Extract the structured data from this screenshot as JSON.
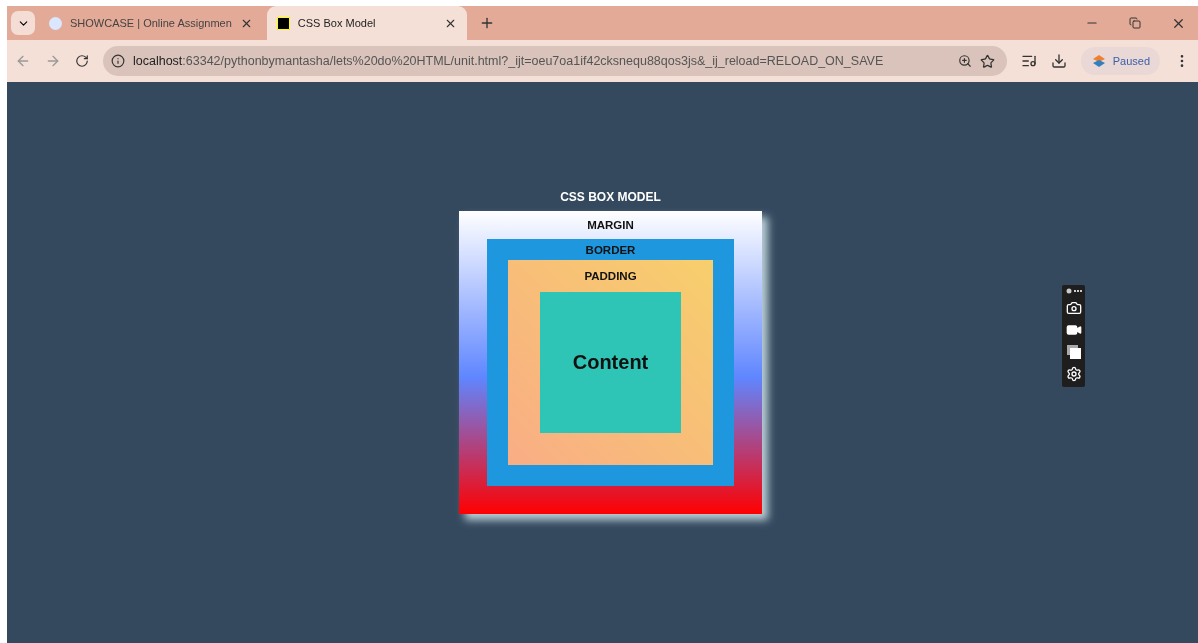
{
  "tabs": [
    {
      "title": "SHOWCASE | Online Assignmen",
      "selected": false
    },
    {
      "title": "CSS Box Model",
      "selected": true
    }
  ],
  "address_bar": {
    "url_host": "localhost",
    "url_rest": ":63342/pythonbymantasha/lets%20do%20HTML/unit.html?_ijt=oeu7oa1if42cksnequ88qos3js&_ij_reload=RELOAD_ON_SAVE"
  },
  "profile": {
    "label": "Paused"
  },
  "box_model": {
    "title": "CSS BOX MODEL",
    "layers": [
      {
        "kind": "margin",
        "label": "MARGIN"
      },
      {
        "kind": "border",
        "label": "BORDER"
      },
      {
        "kind": "padding",
        "label": "PADDING"
      },
      {
        "kind": "content",
        "label": "Content"
      }
    ]
  }
}
